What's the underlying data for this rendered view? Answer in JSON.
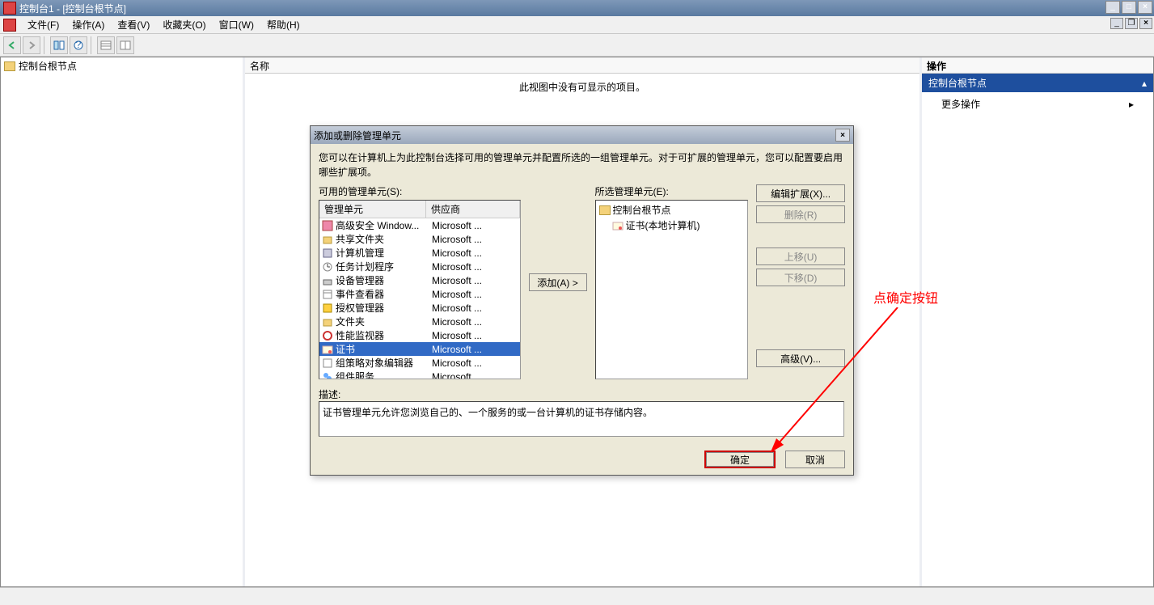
{
  "window": {
    "title": "控制台1 - [控制台根节点]"
  },
  "menu": {
    "file": "文件(F)",
    "action": "操作(A)",
    "view": "查看(V)",
    "favorites": "收藏夹(O)",
    "window": "窗口(W)",
    "help": "帮助(H)"
  },
  "left_tree": {
    "root": "控制台根节点"
  },
  "center": {
    "header": "名称",
    "empty_msg": "此视图中没有可显示的项目。"
  },
  "right": {
    "header": "操作",
    "section": "控制台根节点",
    "more": "更多操作"
  },
  "dialog": {
    "title": "添加或删除管理单元",
    "intro": "您可以在计算机上为此控制台选择可用的管理单元并配置所选的一组管理单元。对于可扩展的管理单元，您可以配置要启用哪些扩展项。",
    "available_label": "可用的管理单元(S):",
    "col_name": "管理单元",
    "col_vendor": "供应商",
    "snapins": [
      {
        "name": "高级安全 Window...",
        "vendor": "Microsoft ..."
      },
      {
        "name": "共享文件夹",
        "vendor": "Microsoft ..."
      },
      {
        "name": "计算机管理",
        "vendor": "Microsoft ..."
      },
      {
        "name": "任务计划程序",
        "vendor": "Microsoft ..."
      },
      {
        "name": "设备管理器",
        "vendor": "Microsoft ..."
      },
      {
        "name": "事件查看器",
        "vendor": "Microsoft ..."
      },
      {
        "name": "授权管理器",
        "vendor": "Microsoft ..."
      },
      {
        "name": "文件夹",
        "vendor": "Microsoft ..."
      },
      {
        "name": "性能监视器",
        "vendor": "Microsoft ..."
      },
      {
        "name": "证书",
        "vendor": "Microsoft ..."
      },
      {
        "name": "组策略对象编辑器",
        "vendor": "Microsoft ..."
      },
      {
        "name": "组件服务",
        "vendor": "Microsoft ..."
      }
    ],
    "selected_index": 9,
    "add_btn": "添加(A) >",
    "selected_label": "所选管理单元(E):",
    "selected_root": "控制台根节点",
    "selected_item": "证书(本地计算机)",
    "edit_ext_btn": "编辑扩展(X)...",
    "remove_btn": "删除(R)",
    "move_up_btn": "上移(U)",
    "move_down_btn": "下移(D)",
    "advanced_btn": "高级(V)...",
    "desc_label": "描述:",
    "desc_text": "证书管理单元允许您浏览自己的、一个服务的或一台计算机的证书存储内容。",
    "ok": "确定",
    "cancel": "取消"
  },
  "annotation": {
    "text": "点确定按钮"
  }
}
